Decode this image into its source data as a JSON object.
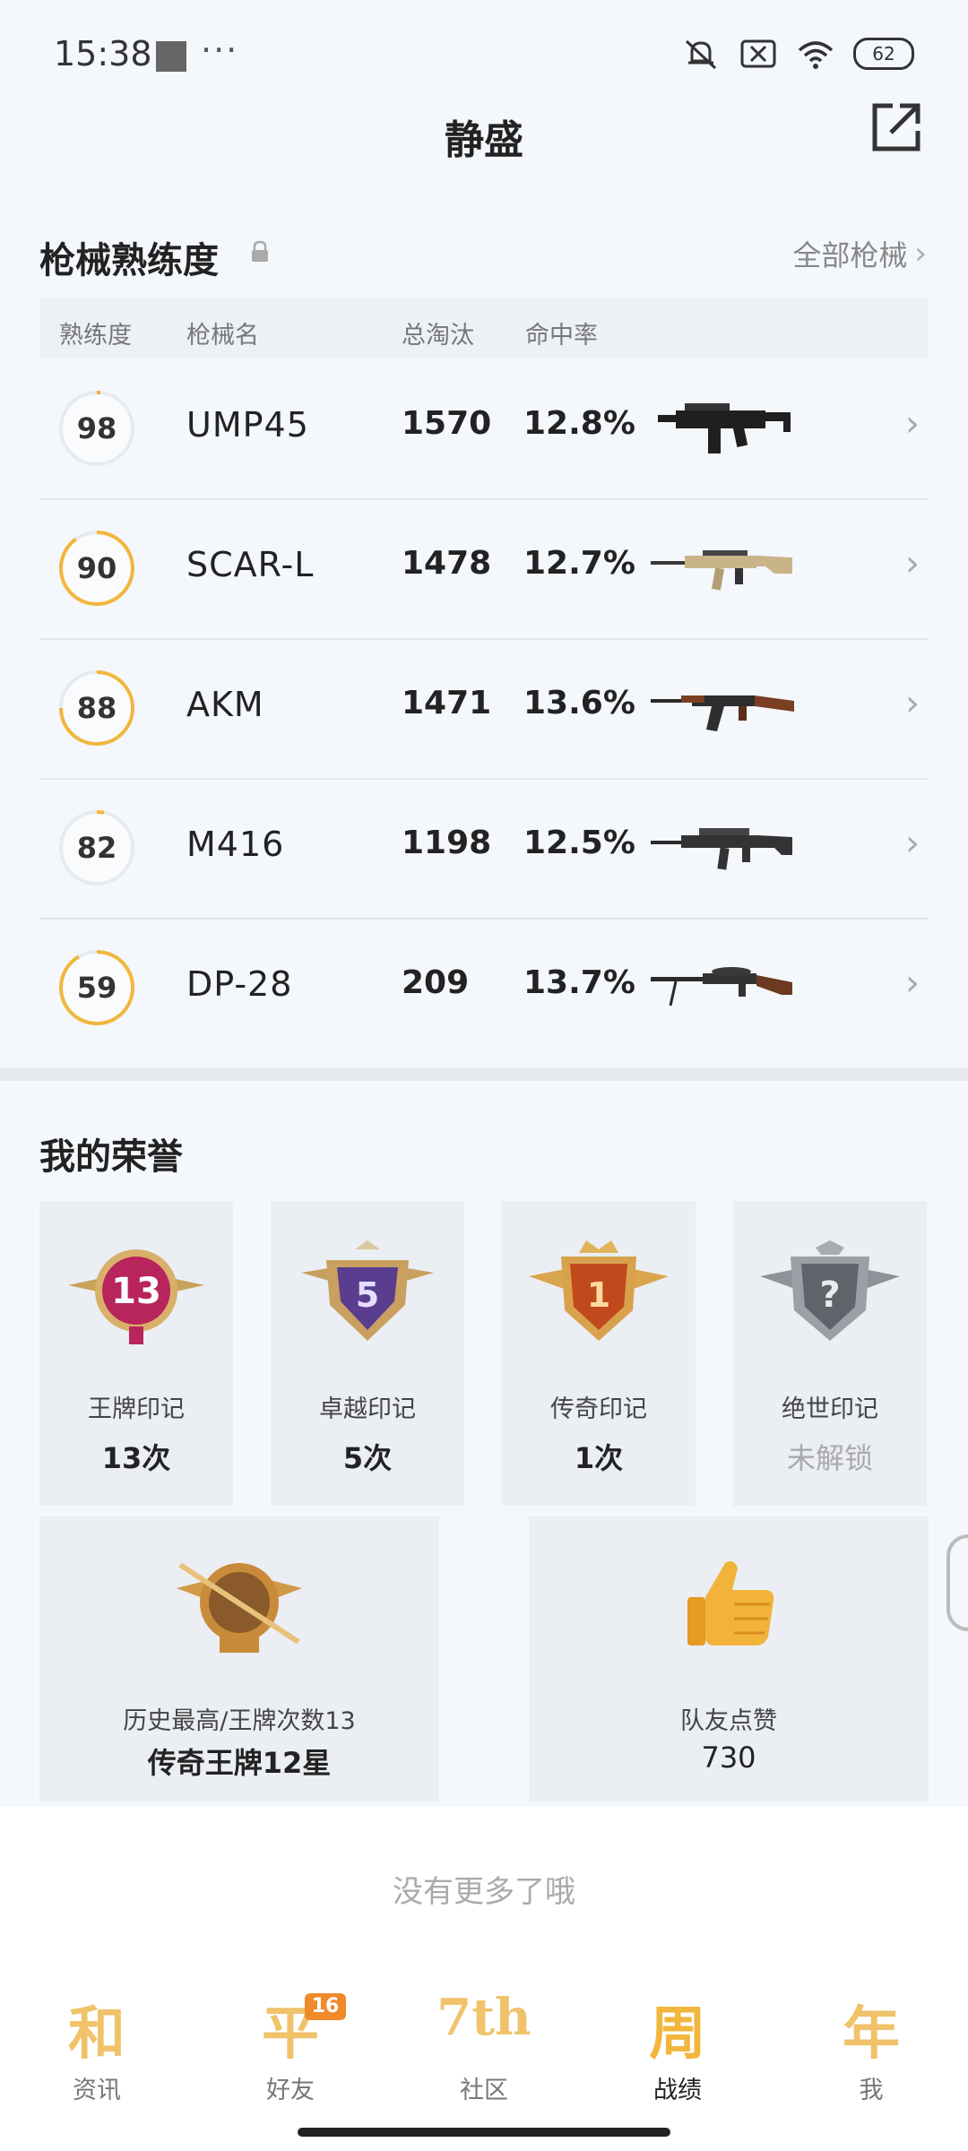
{
  "status_bar": {
    "time": "15:38",
    "dots": "···",
    "battery": "62"
  },
  "header": {
    "title": "静盛"
  },
  "weapons": {
    "section_title": "枪械熟练度",
    "all_link": "全部枪械",
    "columns": {
      "mastery": "熟练度",
      "name": "枪械名",
      "kills": "总淘汰",
      "accuracy": "命中率"
    },
    "rows": [
      {
        "mastery": "98",
        "name": "UMP45",
        "kills": "1570",
        "accuracy": "12.8%"
      },
      {
        "mastery": "90",
        "name": "SCAR-L",
        "kills": "1478",
        "accuracy": "12.7%"
      },
      {
        "mastery": "88",
        "name": "AKM",
        "kills": "1471",
        "accuracy": "13.6%"
      },
      {
        "mastery": "82",
        "name": "M416",
        "kills": "1198",
        "accuracy": "12.5%"
      },
      {
        "mastery": "59",
        "name": "DP-28",
        "kills": "209",
        "accuracy": "13.7%"
      }
    ]
  },
  "honors": {
    "section_title": "我的荣誉",
    "cards": [
      {
        "name": "王牌印记",
        "value": "13次",
        "badge_text": "13"
      },
      {
        "name": "卓越印记",
        "value": "5次",
        "badge_text": "5"
      },
      {
        "name": "传奇印记",
        "value": "1次",
        "badge_text": "1"
      },
      {
        "name": "绝世印记",
        "value": "未解锁",
        "badge_text": "?"
      }
    ],
    "wide_cards": [
      {
        "name": "历史最高/王牌次数13",
        "value": "传奇王牌12星"
      },
      {
        "name": "队友点赞",
        "value": "730"
      }
    ]
  },
  "footer": {
    "no_more": "没有更多了哦"
  },
  "tabs": [
    {
      "glyph": "和",
      "label": "资讯"
    },
    {
      "glyph": "平",
      "label": "好友",
      "badge": "16"
    },
    {
      "glyph": "7th",
      "label": "社区"
    },
    {
      "glyph": "周",
      "label": "战绩"
    },
    {
      "glyph": "年",
      "label": "我"
    }
  ],
  "colors": {
    "accent": "#f2b63c",
    "ring_track": "#e7ebf0"
  }
}
